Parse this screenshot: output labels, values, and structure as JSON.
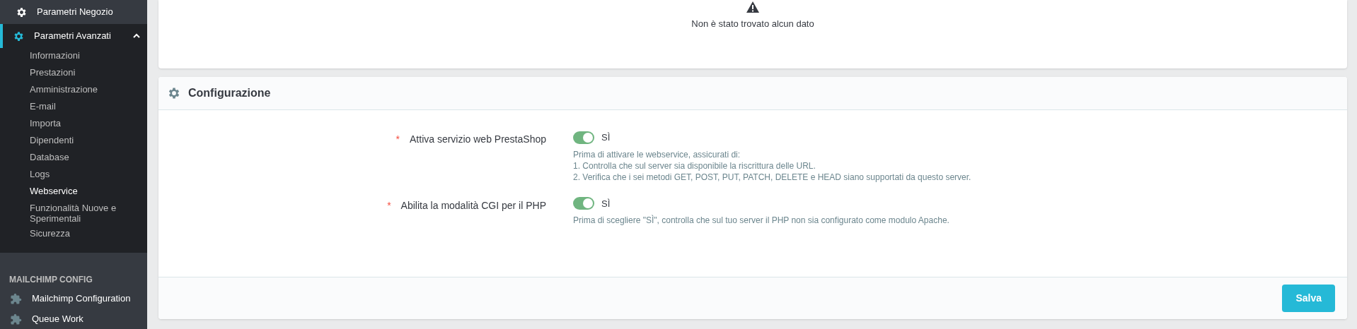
{
  "sidebar": {
    "items": [
      {
        "label": "Parametri Negozio",
        "selected": false,
        "expanded": false
      },
      {
        "label": "Parametri Avanzati",
        "selected": true,
        "expanded": true,
        "children": [
          {
            "label": "Informazioni",
            "selected": false
          },
          {
            "label": "Prestazioni",
            "selected": false
          },
          {
            "label": "Amministrazione",
            "selected": false
          },
          {
            "label": "E-mail",
            "selected": false
          },
          {
            "label": "Importa",
            "selected": false
          },
          {
            "label": "Dipendenti",
            "selected": false
          },
          {
            "label": "Database",
            "selected": false
          },
          {
            "label": "Logs",
            "selected": false
          },
          {
            "label": "Webservice",
            "selected": true
          },
          {
            "label": "Funzionalità Nuove e Sperimentali",
            "selected": false
          },
          {
            "label": "Sicurezza",
            "selected": false
          }
        ]
      }
    ],
    "section": {
      "title": "MAILCHIMP CONFIG",
      "items": [
        {
          "label": "Mailchimp Configuration"
        },
        {
          "label": "Queue Work"
        }
      ]
    }
  },
  "empty_card": {
    "message": "Non è stato trovato alcun dato"
  },
  "config": {
    "title": "Configurazione",
    "fields": [
      {
        "label": "Attiva servizio web PrestaShop",
        "required_mark": "*",
        "on": true,
        "value": "SÌ",
        "help": [
          "Prima di attivare le webservice, assicurati di:",
          "1. Controlla che sul server sia disponibile la riscrittura delle URL.",
          "2. Verifica che i sei metodi GET, POST, PUT, PATCH, DELETE e HEAD siano supportati da questo server."
        ]
      },
      {
        "label": "Abilita la modalità CGI per il PHP",
        "required_mark": "*",
        "on": true,
        "value": "SÌ",
        "help": [
          "Prima di scegliere \"SÌ\", controlla che sul tuo server il PHP non sia configurato come modulo Apache."
        ]
      }
    ],
    "save": "Salva"
  }
}
